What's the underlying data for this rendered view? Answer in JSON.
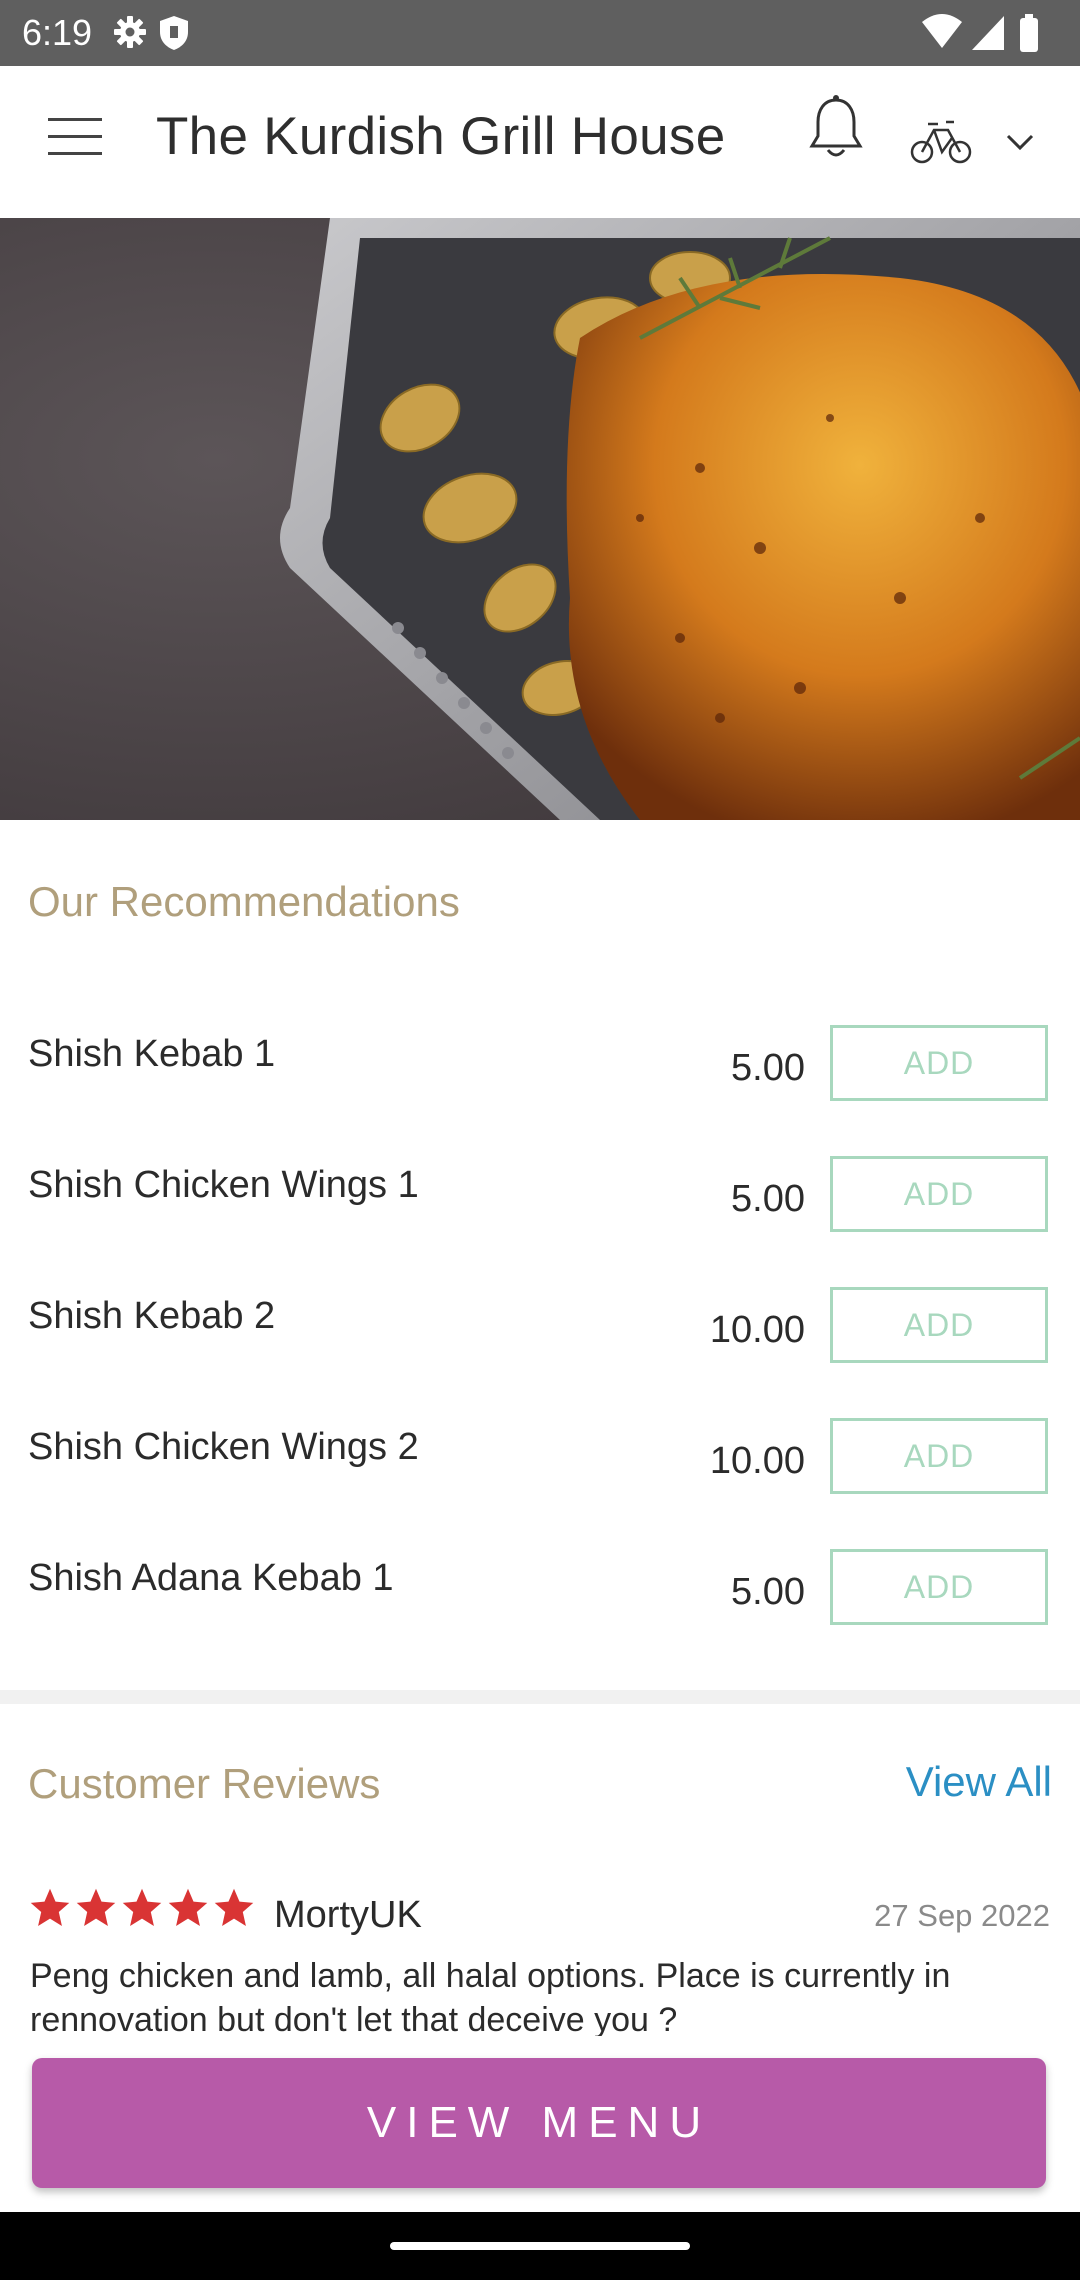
{
  "status_bar": {
    "time": "6:19",
    "icons": [
      "settings-icon",
      "shield-icon",
      "wifi-icon",
      "signal-icon",
      "battery-icon"
    ]
  },
  "app_bar": {
    "title": "The Kurdish Grill House",
    "icons": [
      "hamburger-menu-icon",
      "bell-icon",
      "delivery-icon",
      "chevron-down-icon"
    ]
  },
  "hero": {
    "icon": "roast-chicken-photo"
  },
  "recommendations": {
    "title": "Our Recommendations",
    "items": [
      {
        "name": "Shish Kebab 1",
        "price": "5.00",
        "button": "ADD"
      },
      {
        "name": "Shish Chicken Wings 1",
        "price": "5.00",
        "button": "ADD"
      },
      {
        "name": "Shish Kebab 2",
        "price": "10.00",
        "button": "ADD"
      },
      {
        "name": "Shish Chicken Wings 2",
        "price": "10.00",
        "button": "ADD"
      },
      {
        "name": "Shish Adana Kebab 1",
        "price": "5.00",
        "button": "ADD"
      }
    ]
  },
  "reviews": {
    "title": "Customer Reviews",
    "view_all": "View All",
    "items": [
      {
        "rating": 5,
        "author": "MortyUK",
        "date": "27 Sep 2022",
        "text": "Peng chicken and lamb, all halal options. Place is currently in rennovation but don't let that deceive you ?"
      }
    ]
  },
  "cta": {
    "label": "VIEW MENU"
  },
  "colors": {
    "accent_gold": "#b09f7c",
    "add_green": "#a8d8be",
    "link_blue": "#2b8fc4",
    "cta_purple": "#b75aa8",
    "star_red": "#d93434"
  }
}
